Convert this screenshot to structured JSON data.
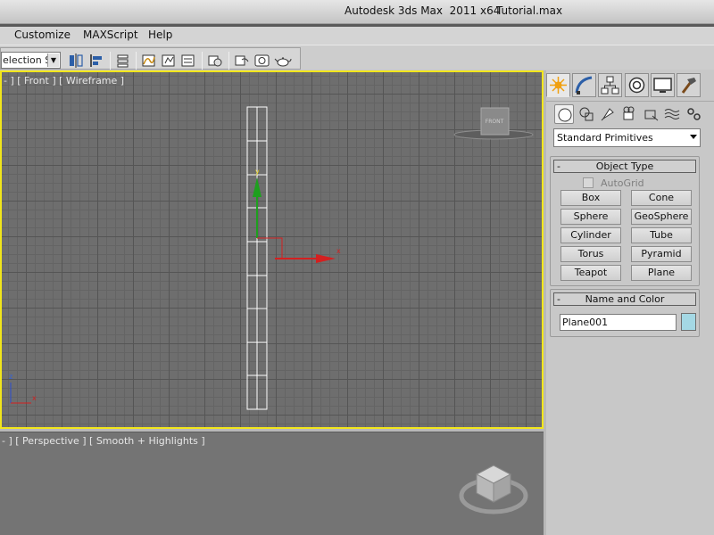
{
  "titlebar": {
    "app_title": "Autodesk 3ds Max  2011 x64",
    "file_title": "Tutorial.max"
  },
  "menu": {
    "items": [
      "Customize",
      "MAXScript",
      "Help"
    ]
  },
  "toolbar": {
    "selection_set": "election Se",
    "icons": [
      "mirror-icon",
      "align-icon",
      "layer-manager-icon",
      "curve-editor-icon",
      "schematic-view-icon",
      "material-editor-icon",
      "render-setup-icon",
      "rendered-frame-window-icon",
      "render-production-icon",
      "render-teapot-icon"
    ]
  },
  "viewports": {
    "front": {
      "label": "- ] [ Front ] [ Wireframe ]",
      "viewcube": "FRONT",
      "gizmo_x": "x",
      "gizmo_y": "y",
      "axis_x": "x",
      "axis_z": "z"
    },
    "perspective": {
      "label": "- ] [ Perspective ] [ Smooth + Highlights ]"
    }
  },
  "command_panel": {
    "tabs": [
      "create-tab",
      "modify-tab",
      "hierarchy-tab",
      "motion-tab",
      "display-tab",
      "utilities-tab"
    ],
    "subcategories": [
      "geometry",
      "shapes",
      "lights",
      "cameras",
      "helpers",
      "space-warps",
      "systems"
    ],
    "primitive_type": "Standard Primitives",
    "object_type": {
      "title": "Object Type",
      "autogrid": "AutoGrid",
      "buttons": [
        "Box",
        "Cone",
        "Sphere",
        "GeoSphere",
        "Cylinder",
        "Tube",
        "Torus",
        "Pyramid",
        "Teapot",
        "Plane"
      ]
    },
    "name_and_color": {
      "title": "Name and Color",
      "name_value": "Plane001",
      "color": "#a4d8e4"
    }
  },
  "colors": {
    "active_viewport_border": "#f2e61b",
    "gizmo_x": "#d42020",
    "gizmo_y": "#1ea01e",
    "wireframe": "#ffffff"
  }
}
